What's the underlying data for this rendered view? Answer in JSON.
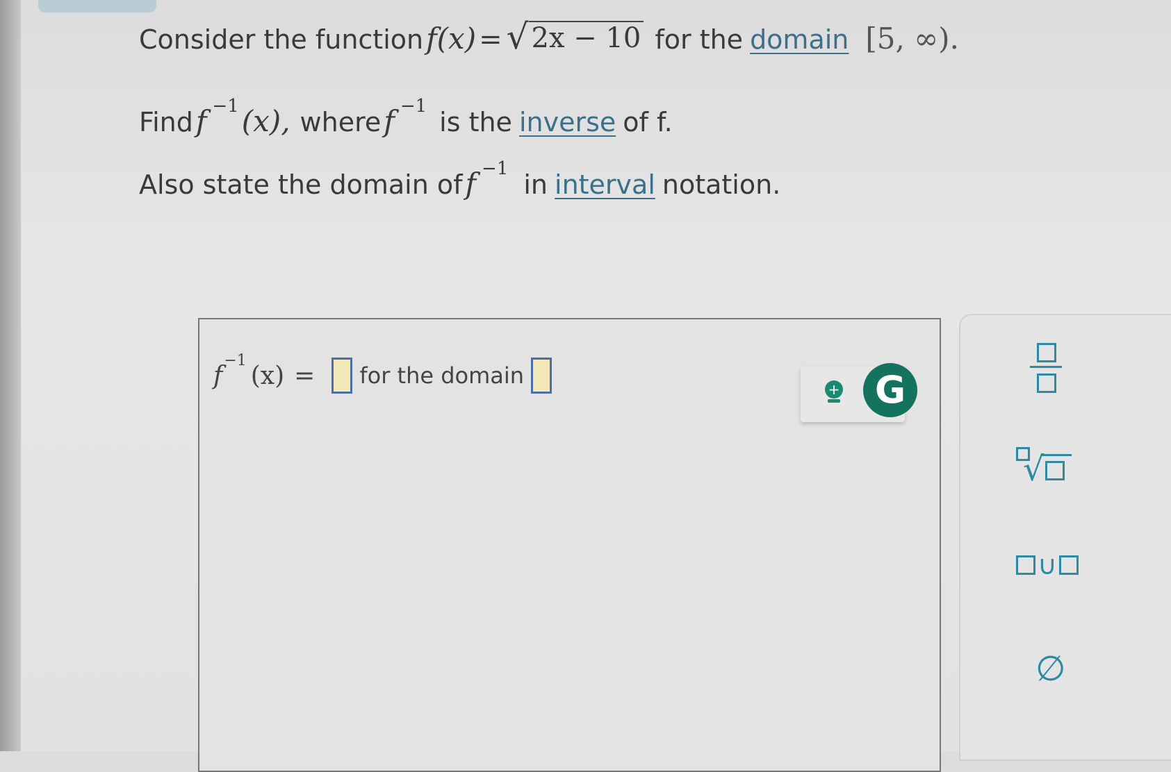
{
  "question": {
    "line1": {
      "prefix": "Consider the function",
      "f_of_x": "f(x)",
      "equals": "=",
      "radicand": "2x − 10",
      "for_the": "for the",
      "domain_link": "domain",
      "interval": "[5, ∞)."
    },
    "line2": {
      "find": "Find",
      "f": "f",
      "sup": "−1",
      "arg": "(x),",
      "where": "where",
      "f2": "f",
      "sup2": "−1",
      "is_the": "is the",
      "inverse_link": "inverse",
      "of_f": "of f."
    },
    "line3": {
      "prefix": "Also state the domain of",
      "f": "f",
      "sup": "−1",
      "in": "in",
      "interval_link": "interval",
      "suffix": "notation."
    }
  },
  "answer": {
    "f": "f",
    "sup": "−1",
    "arg": "(x)",
    "equals": "=",
    "for_the_domain": "for the domain"
  },
  "tools": {
    "g_label": "G",
    "hint_glyph": "+"
  },
  "palette": {
    "root_sign": "√",
    "union_symbol": "∪",
    "empty_set": "∅"
  },
  "colors": {
    "link": "#3b6f8a",
    "accent": "#2d8aa0",
    "g_button": "#14735f",
    "slot_fill": "#f2e7b8",
    "slot_border": "#4a6fa8"
  }
}
